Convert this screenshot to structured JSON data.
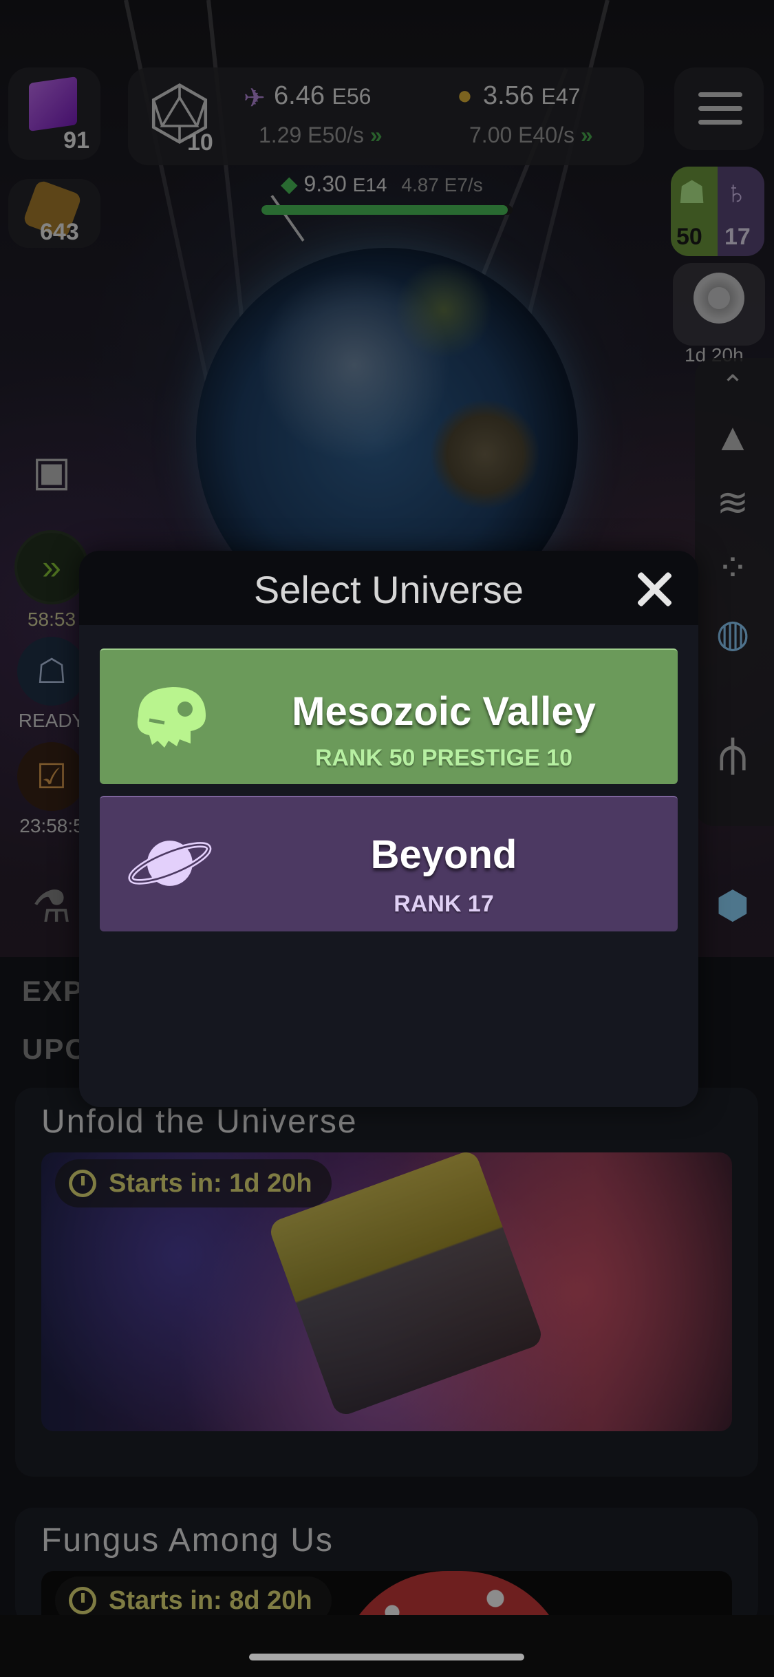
{
  "hud": {
    "cube_count": "91",
    "honeycomb_count": "643",
    "d20_level": "10",
    "resource1": {
      "value": "6.46",
      "exp": "E56",
      "rate": "1.29",
      "rate_exp": "E50/s"
    },
    "resource2": {
      "value": "3.56",
      "exp": "E47",
      "rate": "7.00",
      "rate_exp": "E40/s"
    },
    "xp": {
      "value": "9.30",
      "exp": "E14",
      "rate": "4.87",
      "rate_exp": "E7/s",
      "fill": 0.98
    },
    "universe_rank_a": "50",
    "universe_rank_b": "17",
    "hex_timer": "1d 20h",
    "chevrons": "»"
  },
  "left_column": {
    "boost_timer": "58:53",
    "ghost_label": "READY",
    "calendar_timer": "23:58:5"
  },
  "lower": {
    "section1": "EXP",
    "section2": "UPC",
    "card1_title": "Unfold the Universe",
    "card1_timer": "Starts in: 1d 20h",
    "card2_title": "Fungus Among Us",
    "card2_timer": "Starts in: 8d 20h"
  },
  "modal": {
    "title": "Select Universe",
    "universes": [
      {
        "name": "Mesozoic Valley",
        "subtitle": "RANK 50  PRESTIGE 10",
        "icon": "dinosaur-skull-icon",
        "color": "#6b9a5a"
      },
      {
        "name": "Beyond",
        "subtitle": "RANK 17",
        "icon": "planet-icon",
        "color": "#4c3962"
      }
    ]
  },
  "colors": {
    "accent_green": "#4cc15a",
    "timer_yellow": "#e8e27a"
  }
}
